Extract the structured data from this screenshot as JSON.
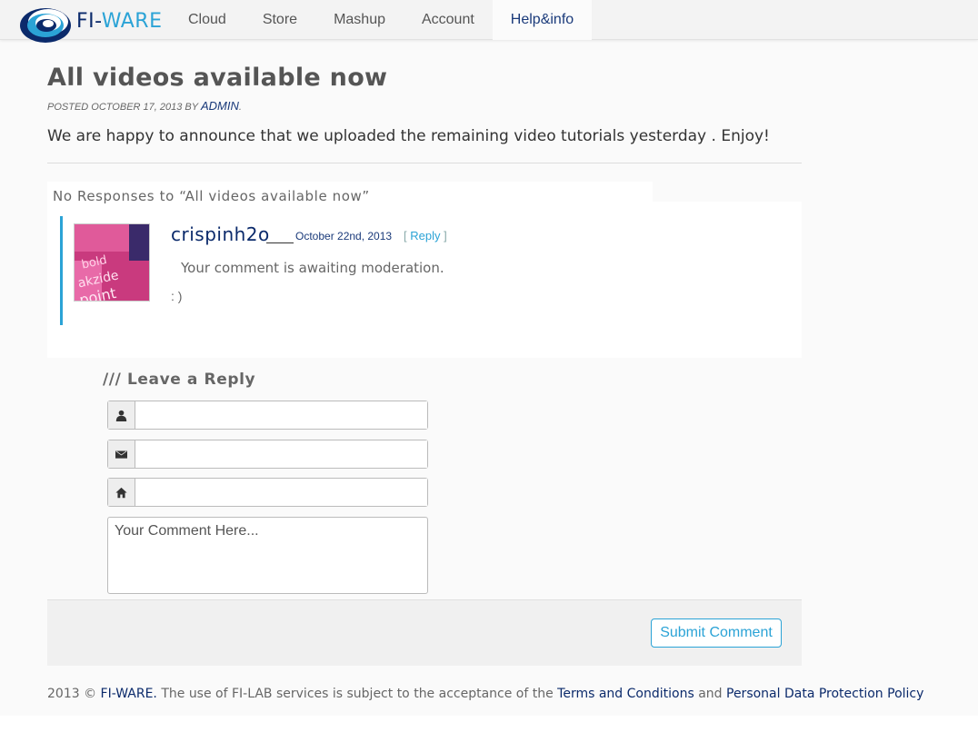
{
  "header": {
    "logo_prefix": "FI-",
    "logo_suffix": "WARE",
    "nav": [
      {
        "label": "Cloud"
      },
      {
        "label": "Store"
      },
      {
        "label": "Mashup"
      },
      {
        "label": "Account"
      },
      {
        "label": "Help&info"
      }
    ],
    "active_nav": "Help&info"
  },
  "post": {
    "title": "All videos available now",
    "meta_prefix": "POSTED OCTOBER 17, 2013 BY ",
    "author": "ADMIN",
    "meta_suffix": ".",
    "body": "We are happy to announce that we uploaded the remaining video tutorials yesterday . Enjoy!"
  },
  "responses": {
    "heading": "No Responses to “All videos available now”",
    "comments": [
      {
        "author": "crispinh2o",
        "date": "October 22nd, 2013",
        "reply_open": "[ ",
        "reply_label": "Reply",
        "reply_close": " ]",
        "moderation": "Your comment is awaiting moderation.",
        "text": ": )",
        "avatar_words": [
          "bold",
          "akzide",
          "point"
        ]
      }
    ]
  },
  "reply_form": {
    "title": "/// Leave a Reply",
    "comment_placeholder": "Your Comment Here...",
    "submit_label": "Submit Comment"
  },
  "footer": {
    "copyright": "2013 © ",
    "brand": "FI-WARE.",
    "text": " The use of FI-LAB services is subject to the acceptance of the ",
    "terms": "Terms and Conditions",
    "and": " and ",
    "privacy": "Personal Data Protection Policy"
  },
  "colors": {
    "accent": "#2ba3d6",
    "brand_dark": "#0b2a6b"
  }
}
